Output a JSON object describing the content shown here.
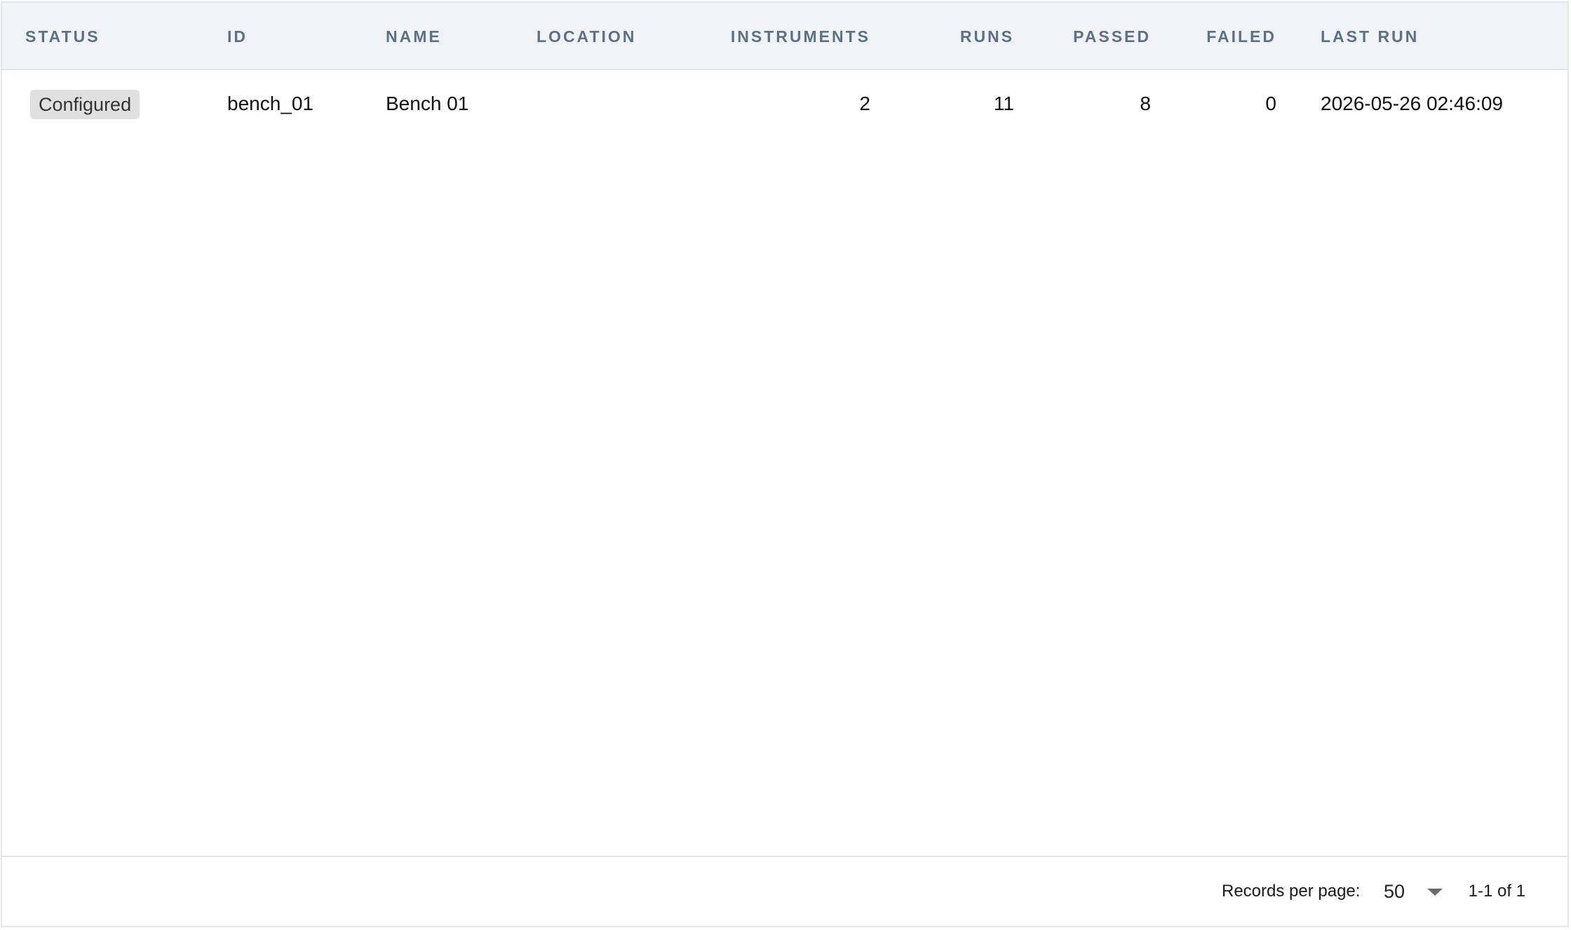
{
  "table": {
    "columns": {
      "status": "STATUS",
      "id": "ID",
      "name": "NAME",
      "location": "LOCATION",
      "instruments": "INSTRUMENTS",
      "runs": "RUNS",
      "passed": "PASSED",
      "failed": "FAILED",
      "last_run": "LAST RUN"
    },
    "rows": [
      {
        "status": "Configured",
        "id": "bench_01",
        "name": "Bench 01",
        "location": "",
        "instruments": "2",
        "runs": "11",
        "passed": "8",
        "failed": "0",
        "last_run": "2026-05-26 02:46:09"
      }
    ]
  },
  "footer": {
    "records_per_page_label": "Records per page:",
    "records_per_page_value": "50",
    "page_range": "1-1 of 1"
  },
  "colors": {
    "header_bg": "#f0f4f8",
    "header_text": "#5c7088",
    "status_badge_bg": "#e0e0e0",
    "border": "#e3e6ea"
  }
}
